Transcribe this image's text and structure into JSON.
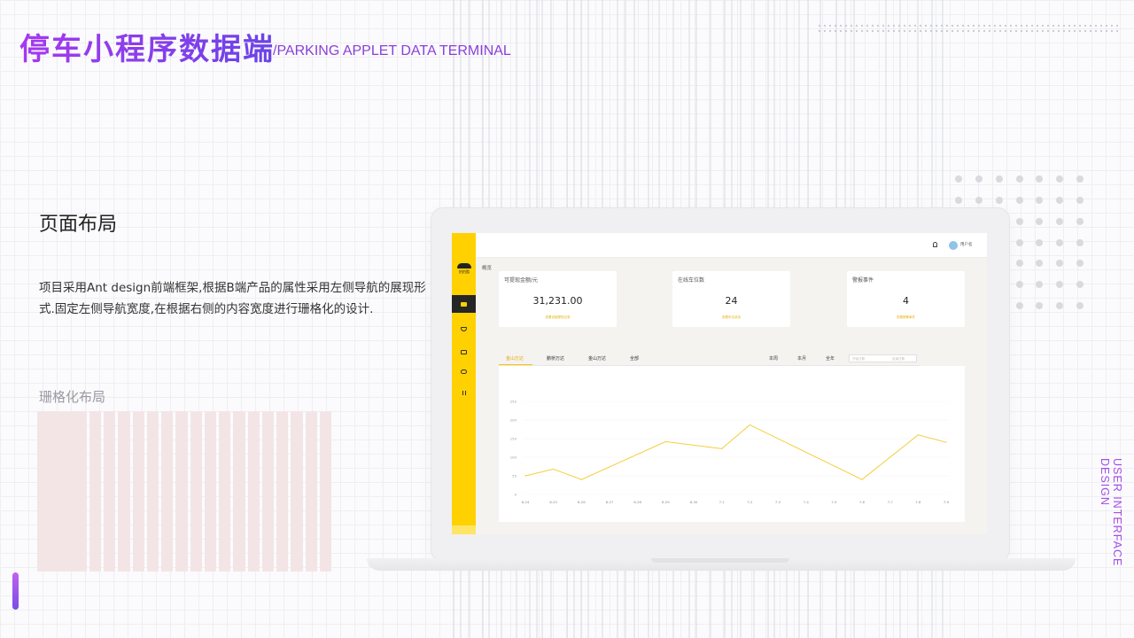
{
  "header": {
    "title": "停车小程序数据端",
    "subtitle": "/PARKING APPLET DATA TERMINAL"
  },
  "intro": {
    "heading": "页面布局",
    "description": "项目采用Ant design前端框架,根据B端产品的属性采用左侧导航的展现形式.固定左侧导航宽度,在根据右侧的内容宽度进行珊格化的设计.",
    "grid_label": "珊格化布局"
  },
  "side_caption": "USER INTERFACE DESIGN",
  "app": {
    "logo_text": "拍拍酷",
    "sidebar_icons": [
      "dashboard-icon",
      "shield-icon",
      "card-icon",
      "chat-icon",
      "bars-icon"
    ],
    "user_name": "用户名",
    "breadcrumb": "概览",
    "stats": [
      {
        "label": "可提现金额/元",
        "value": "31,231.00",
        "link": "查看详细提现记录"
      },
      {
        "label": "在线车位数",
        "value": "24",
        "link": "查看车位状态"
      },
      {
        "label": "警报事件",
        "value": "4",
        "link": "查看报警事件"
      }
    ],
    "tabs": [
      "金山万达",
      "鹏桥万达",
      "金山万达",
      "全部"
    ],
    "periods": [
      "本周",
      "本月",
      "全年"
    ],
    "date_start": "开始日期",
    "date_end": "结束日期"
  },
  "colors": {
    "accent": "#ffd100",
    "line": "#f5cd3a",
    "title_gradient_start": "#a638f0",
    "title_gradient_end": "#6b44e6"
  },
  "chart_data": {
    "type": "line",
    "categories": [
      "6-24",
      "6-25",
      "6-26",
      "6-27",
      "6-28",
      "6-29",
      "6-30",
      "7-1",
      "7-2",
      "7-3",
      "7-4",
      "7-5",
      "7-6",
      "7-7",
      "7-8",
      "7-9"
    ],
    "series": [
      {
        "values": [
          55,
          70,
          40,
          null,
          null,
          145,
          null,
          125,
          190,
          null,
          null,
          null,
          42,
          null,
          162,
          142
        ]
      }
    ],
    "line_points": [
      [
        0,
        50
      ],
      [
        1,
        68
      ],
      [
        2,
        40
      ],
      [
        5,
        142
      ],
      [
        7,
        123
      ],
      [
        8,
        187
      ],
      [
        12,
        40
      ],
      [
        14,
        160
      ],
      [
        15,
        140
      ]
    ],
    "yticks": [
      0,
      50,
      100,
      150,
      200,
      250
    ],
    "ylim": [
      0,
      250
    ],
    "grid": true
  }
}
